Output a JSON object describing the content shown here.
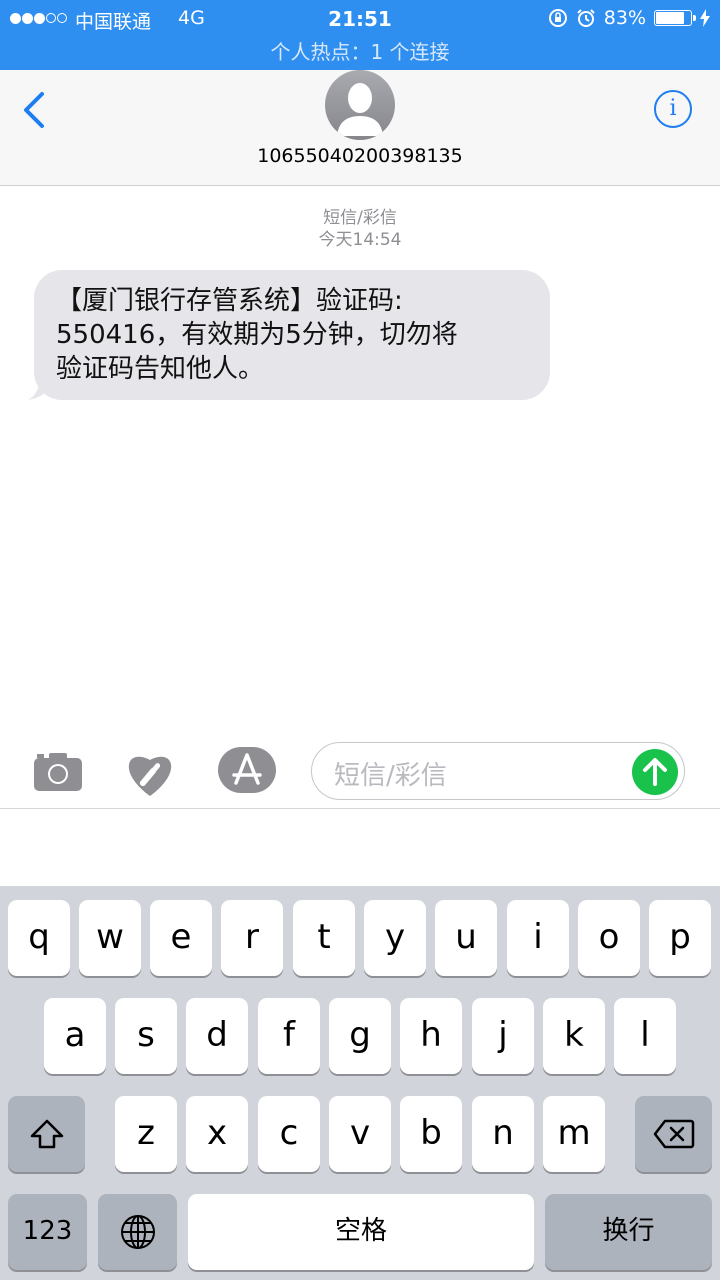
{
  "status_bar": {
    "carrier": "中国联通",
    "network": "4G",
    "time": "21:51",
    "battery": "83%",
    "battery_level": 0.83,
    "hotspot": "个人热点：1 个连接",
    "color": "#2f8ff0"
  },
  "header": {
    "contact": "10655040200398135",
    "back_icon": "chevron-left-icon",
    "info_icon": "info-icon",
    "info_glyph": "i"
  },
  "conversation": {
    "type": "短信/彩信",
    "timestamp": "今天14:54",
    "messages": [
      {
        "lines": [
          "【厦门银行存管系统】验证码:",
          "550416，有效期为5分钟，切勿将",
          "验证码告知他人。"
        ]
      }
    ]
  },
  "compose": {
    "placeholder": "短信/彩信",
    "send_color": "#19c24b"
  },
  "keyboard": {
    "row1": [
      "q",
      "w",
      "e",
      "r",
      "t",
      "y",
      "u",
      "i",
      "o",
      "p"
    ],
    "row2": [
      "a",
      "s",
      "d",
      "f",
      "g",
      "h",
      "j",
      "k",
      "l"
    ],
    "row3": [
      "z",
      "x",
      "c",
      "v",
      "b",
      "n",
      "m"
    ],
    "numbers": "123",
    "space": "空格",
    "return": "换行"
  }
}
